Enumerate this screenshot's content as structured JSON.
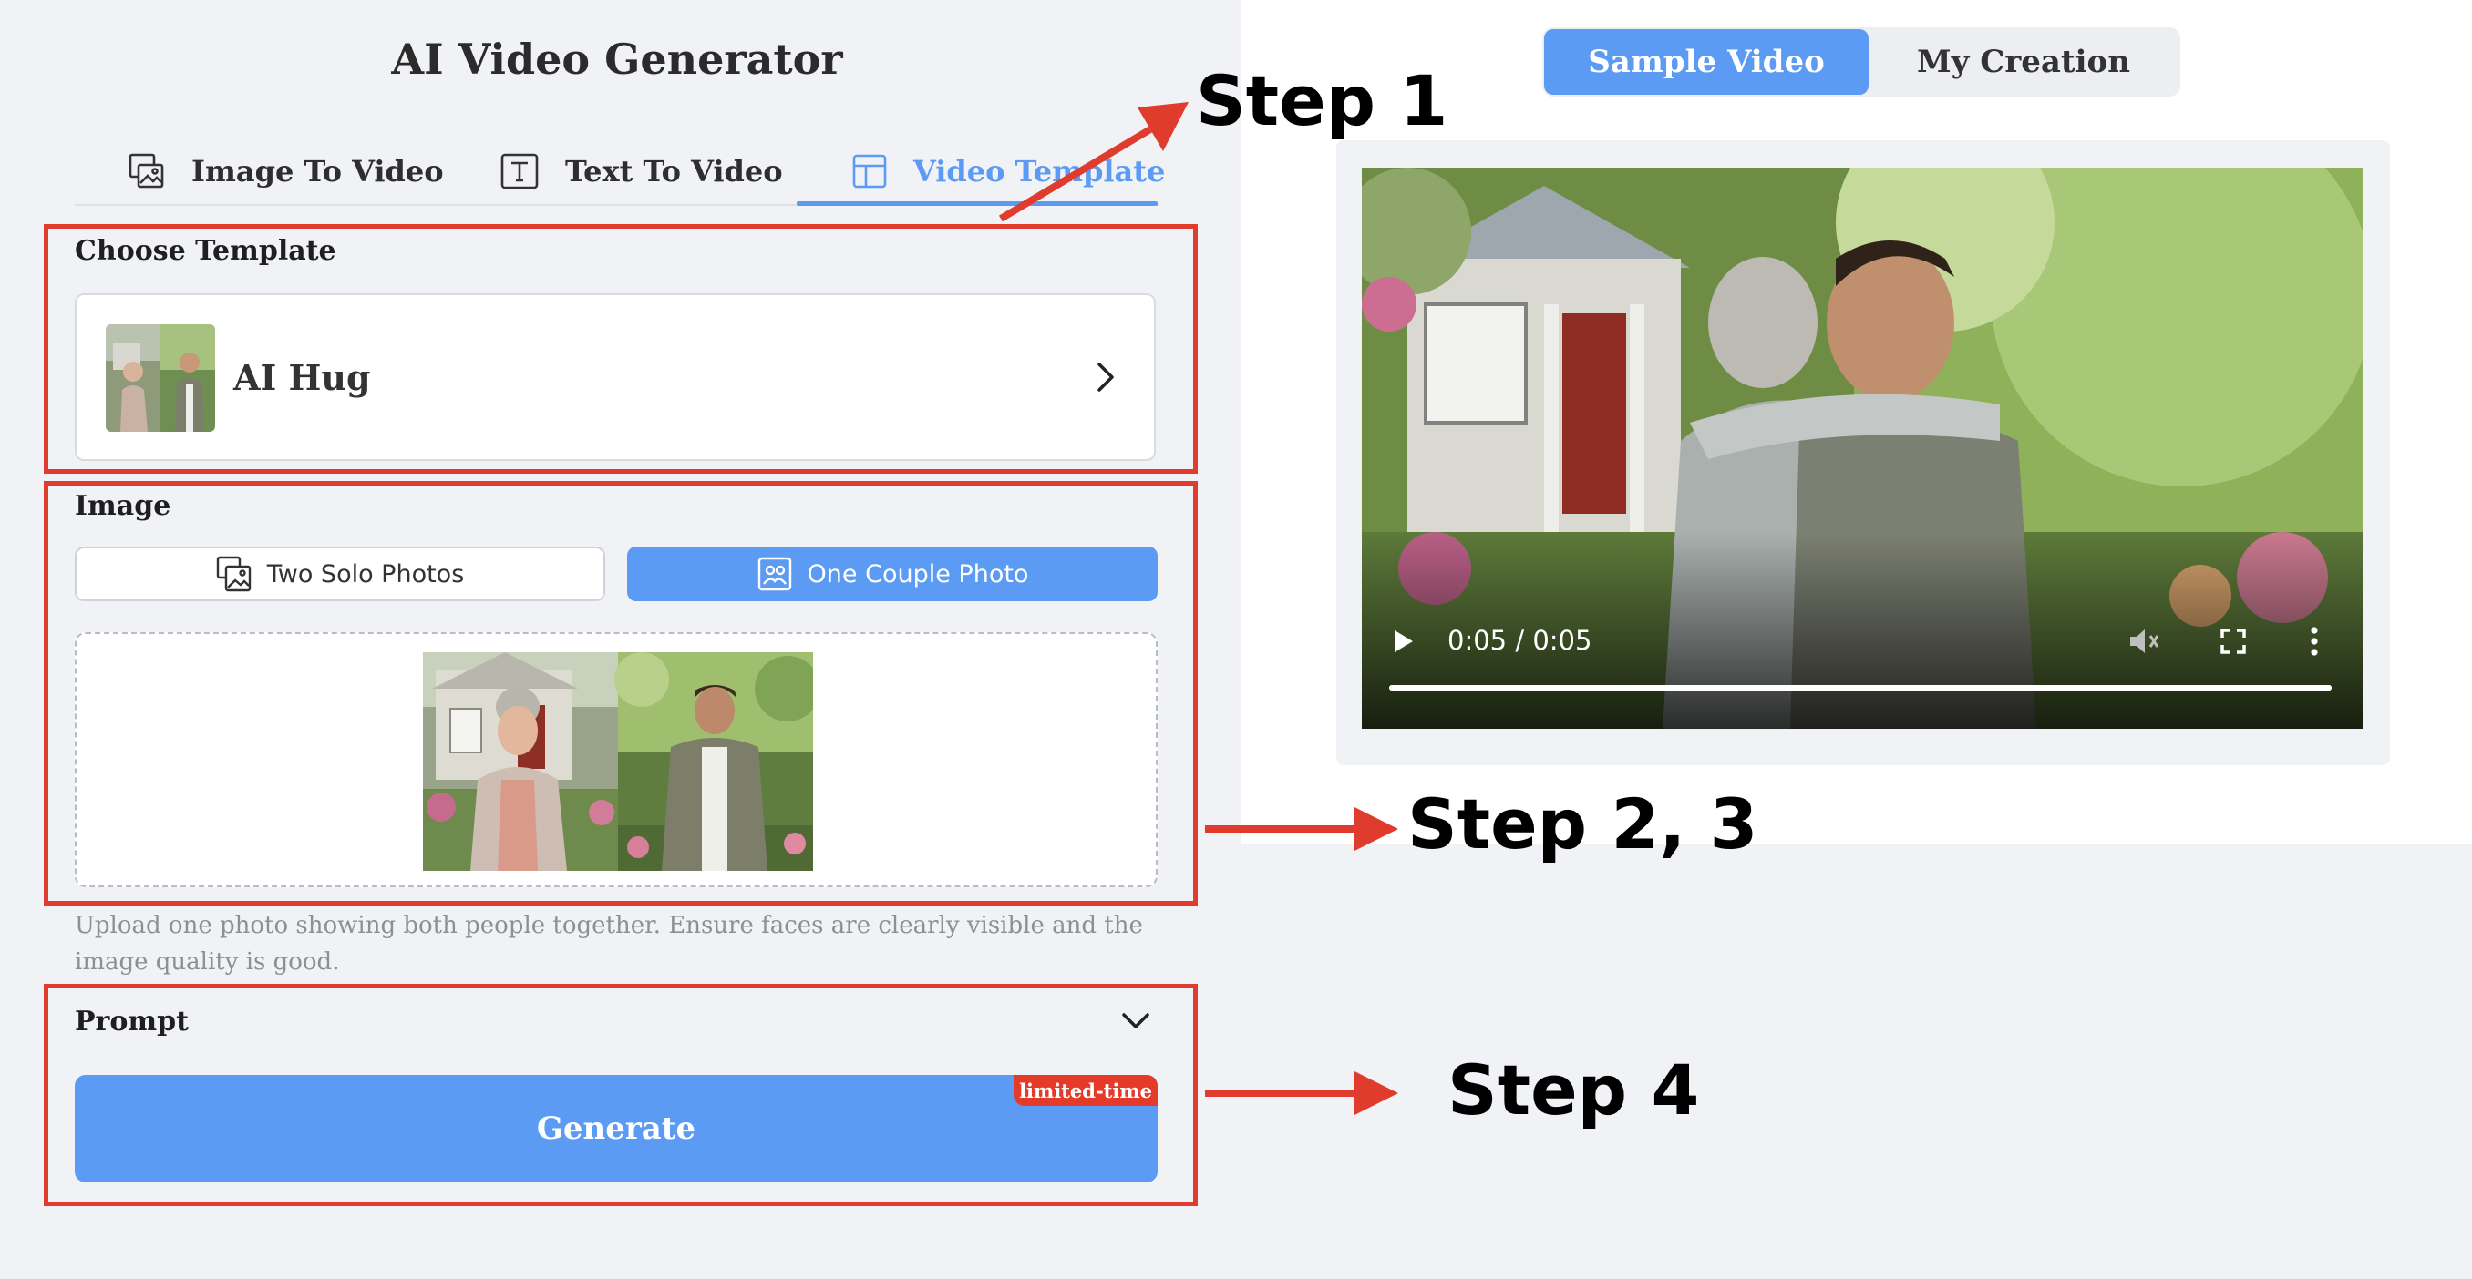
{
  "app": {
    "title": "AI Video Generator"
  },
  "tabs": [
    {
      "label": "Image To Video",
      "icon": "image-to-video-icon",
      "active": false
    },
    {
      "label": "Text To Video",
      "icon": "text-box-icon",
      "active": false
    },
    {
      "label": "Video Template",
      "icon": "template-layout-icon",
      "active": true
    }
  ],
  "template": {
    "section_label": "Choose Template",
    "selected_name": "AI Hug"
  },
  "image": {
    "section_label": "Image",
    "modes": [
      {
        "label": "Two Solo Photos",
        "icon": "two-photos-icon",
        "selected": false
      },
      {
        "label": "One Couple Photo",
        "icon": "couple-photo-icon",
        "selected": true
      }
    ],
    "hint": "Upload one photo showing both people together. Ensure faces are clearly visible and the image quality is good."
  },
  "prompt": {
    "label": "Prompt"
  },
  "generate": {
    "label": "Generate",
    "badge": "limited-time"
  },
  "preview": {
    "tabs": [
      "Sample Video",
      "My Creation"
    ],
    "active_tab": "Sample Video",
    "video": {
      "time": "0:05 / 0:05",
      "progress": 1.0
    }
  },
  "annotations": {
    "step1": "Step 1",
    "step23": "Step 2, 3",
    "step4": "Step 4"
  },
  "colors": {
    "accent": "#5b9bf4",
    "annotation_red": "#e03c2e",
    "badge_red": "#e43a2a",
    "page_bg": "#f1f2f6"
  }
}
